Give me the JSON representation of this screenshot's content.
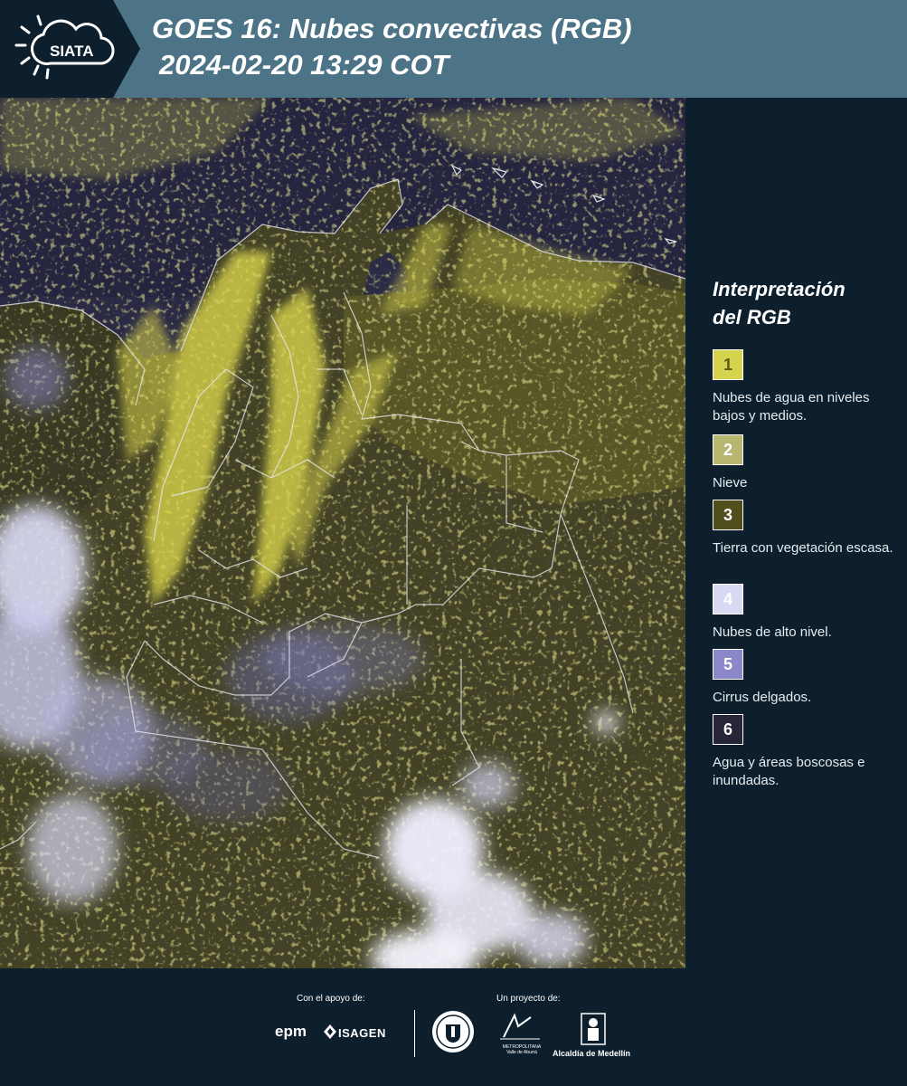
{
  "header": {
    "logo_text": "SIATA",
    "title": "GOES 16: Nubes convectivas (RGB)",
    "timestamp": "2024-02-20 13:29 COT"
  },
  "legend": {
    "title_line1": "Interpretación",
    "title_line2": "del RGB",
    "items": [
      {
        "number": "1",
        "label": "Nubes de agua en niveles bajos y medios.",
        "color": "#d6d34e",
        "text_color": "#5a5a10"
      },
      {
        "number": "2",
        "label": "Nieve",
        "color": "#b7b772",
        "text_color": "#ffffff"
      },
      {
        "number": "3",
        "label": "Tierra con vegetación escasa.",
        "color": "#4f4e1c",
        "text_color": "#ffffff"
      },
      {
        "number": "4",
        "label": "Nubes de alto nivel.",
        "color": "#d9d9f3",
        "text_color": "#ffffff"
      },
      {
        "number": "5",
        "label": "Cirrus delgados.",
        "color": "#8a88c8",
        "text_color": "#ffffff"
      },
      {
        "number": "6",
        "label": "Agua y áreas boscosas e inundadas.",
        "color": "#262638",
        "text_color": "#ffffff"
      }
    ]
  },
  "footer": {
    "support_label": "Con el apoyo de:",
    "project_label": "Un proyecto de:",
    "epm": "epm",
    "isagen": "ISAGEN",
    "area_text": "METROPOLITANA Valle de Aburrá",
    "alcaldia": "Alcaldía de Medellín"
  },
  "colors": {
    "header_bg": "#4d7486",
    "panel_bg": "#0d1f2c",
    "ocean": "#2a2a44",
    "land_cloud": "#d8d650",
    "high_cloud": "#dcdcf6"
  }
}
